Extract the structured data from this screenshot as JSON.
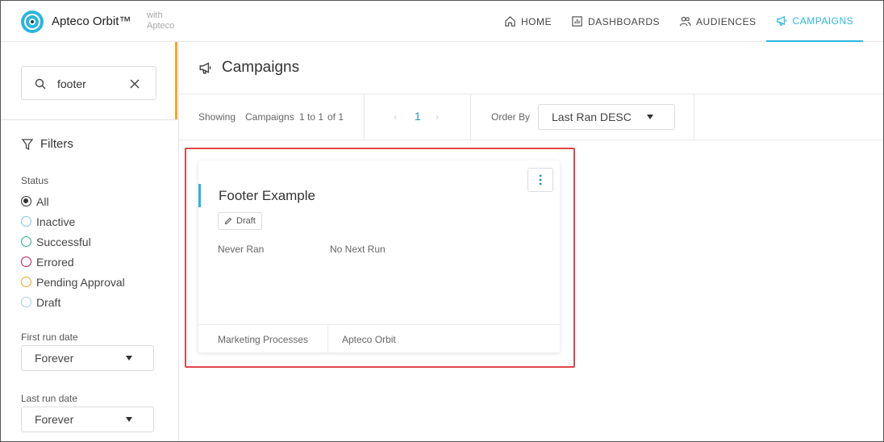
{
  "app": {
    "brand": "Apteco Orbit™",
    "with_line1": "with",
    "with_line2": "Apteco",
    "accent_color": "#2bb6dc"
  },
  "nav": {
    "items": [
      {
        "label": "HOME",
        "icon": "home-icon"
      },
      {
        "label": "DASHBOARDS",
        "icon": "dashboard-icon"
      },
      {
        "label": "AUDIENCES",
        "icon": "audiences-icon"
      },
      {
        "label": "CAMPAIGNS",
        "icon": "megaphone-icon",
        "active": true
      }
    ]
  },
  "sidebar": {
    "search": {
      "value": "footer",
      "placeholder": ""
    },
    "filters_title": "Filters",
    "status_label": "Status",
    "statuses": [
      {
        "label": "All",
        "checked": true,
        "color": "#333333"
      },
      {
        "label": "Inactive",
        "color": "#7fc8d8"
      },
      {
        "label": "Successful",
        "color": "#2bb08a"
      },
      {
        "label": "Errored",
        "color": "#c2185b"
      },
      {
        "label": "Pending Approval",
        "color": "#f5a623"
      },
      {
        "label": "Draft",
        "color": "#9ecfe0"
      }
    ],
    "first_run_label": "First run date",
    "first_run_value": "Forever",
    "last_run_label": "Last run date",
    "last_run_value": "Forever"
  },
  "main": {
    "title": "Campaigns",
    "toolbar": {
      "showing": "Showing",
      "entity": "Campaigns",
      "range": "1 to 1",
      "of": "of 1",
      "prev": "‹",
      "page": "1",
      "next": "›",
      "order_by_label": "Order By",
      "order_by_value": "Last Ran DESC"
    },
    "card": {
      "title": "Footer Example",
      "status": "Draft",
      "last_run": "Never Ran",
      "next_run": "No Next Run",
      "footer_left": "Marketing Processes",
      "footer_right": "Apteco Orbit"
    }
  }
}
